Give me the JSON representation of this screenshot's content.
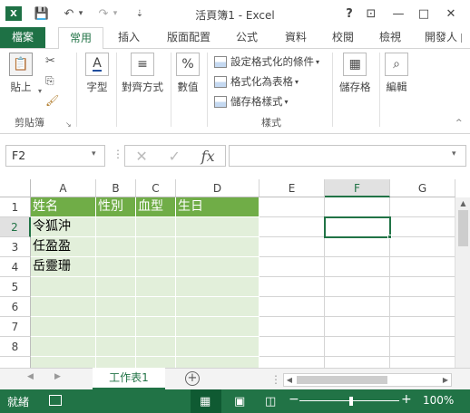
{
  "window": {
    "title": "活頁簿1 - Excel",
    "logo": "X",
    "help": "?",
    "ribbon_display": "⊡",
    "minimize": "—",
    "maximize": "□",
    "close": "✕"
  },
  "quick_access": {
    "save": "💾",
    "undo": "↶",
    "undo_drop": "▾",
    "redo": "↷",
    "redo_drop": "▾",
    "customize": "⇣"
  },
  "tabs": [
    "檔案",
    "常用",
    "插入",
    "版面配置",
    "公式",
    "資料",
    "校閱",
    "檢視",
    "開發人"
  ],
  "ribbon": {
    "paste_label": "貼上",
    "clipboard_group": "剪貼簿",
    "font_label": "字型",
    "align_label": "對齊方式",
    "number_label": "數值",
    "cond_format": "設定格式化的條件",
    "format_table": "格式化為表格",
    "cell_styles": "儲存格樣式",
    "styles_group": "樣式",
    "cells_label": "儲存格",
    "edit_label": "編輯"
  },
  "formula_bar": {
    "name_box": "F2",
    "cancel": "✕",
    "enter": "✓",
    "fx": "fx",
    "value": ""
  },
  "columns": [
    "A",
    "B",
    "C",
    "D",
    "E",
    "F",
    "G"
  ],
  "rows": [
    "1",
    "2",
    "3",
    "4",
    "5",
    "6",
    "7",
    "8"
  ],
  "cells": {
    "A1": "姓名",
    "B1": "性別",
    "C1": "血型",
    "D1": "生日",
    "A2": "令狐沖",
    "A3": "任盈盈",
    "A4": "岳靈珊"
  },
  "sheet": {
    "tab": "工作表1",
    "add": "+",
    "prev": "◀",
    "next": "▶"
  },
  "status": {
    "ready": "就緒",
    "zoom": "100%",
    "zoom_out": "−",
    "zoom_in": "+"
  }
}
